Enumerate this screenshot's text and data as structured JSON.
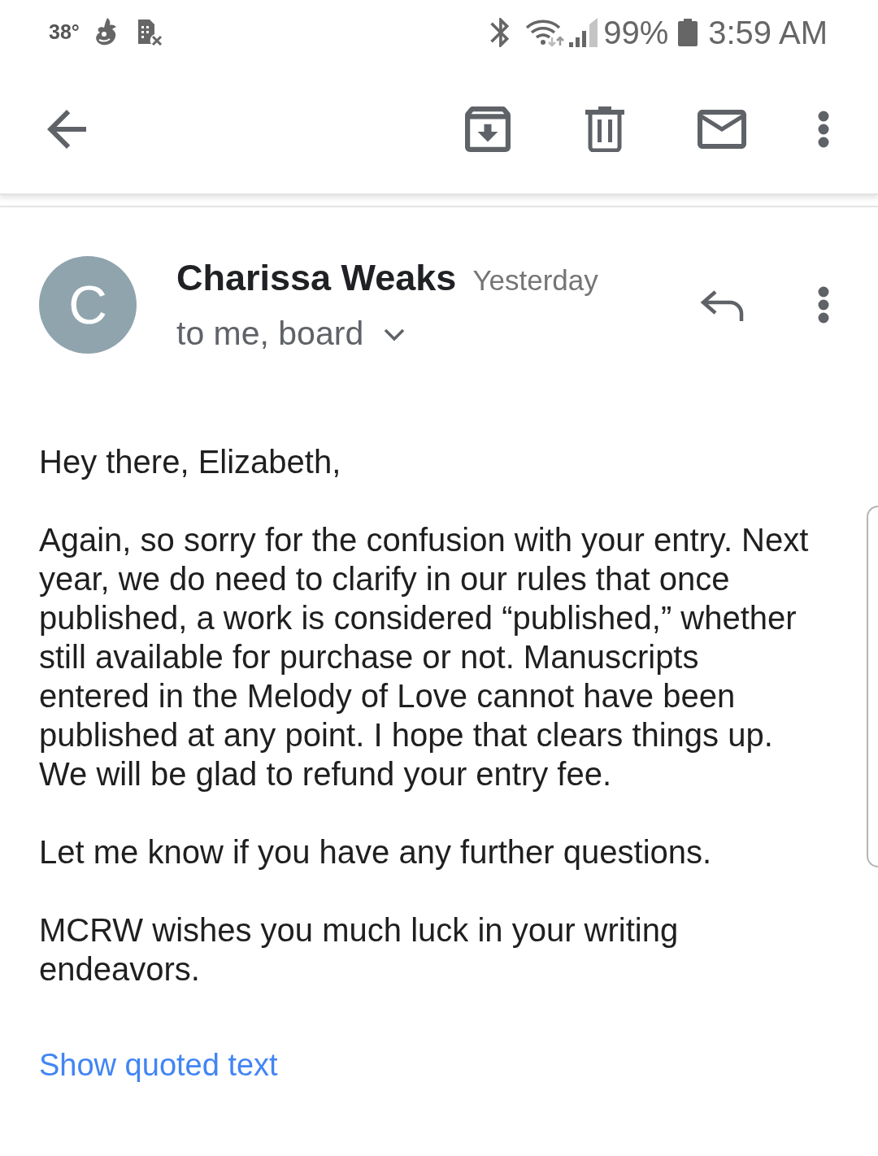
{
  "status_bar": {
    "temperature": "38°",
    "battery": "99%",
    "time": "3:59 AM"
  },
  "message": {
    "avatar_letter": "C",
    "sender": "Charissa Weaks",
    "date": "Yesterday",
    "recipients": "to me, board",
    "body": [
      "Hey there, Elizabeth,",
      "Again, so sorry for the confusion with your entry. Next year, we do need to clarify in our rules that once published, a work is considered “published,” whether still available for purchase or not. Manuscripts entered in the Melody of Love cannot have been published at any point. I hope that clears things up. We will be glad to refund your entry fee.",
      "Let me know if you have any further questions.",
      "MCRW wishes you much luck in your writing endeavors."
    ],
    "show_quoted_text": "Show quoted text"
  }
}
